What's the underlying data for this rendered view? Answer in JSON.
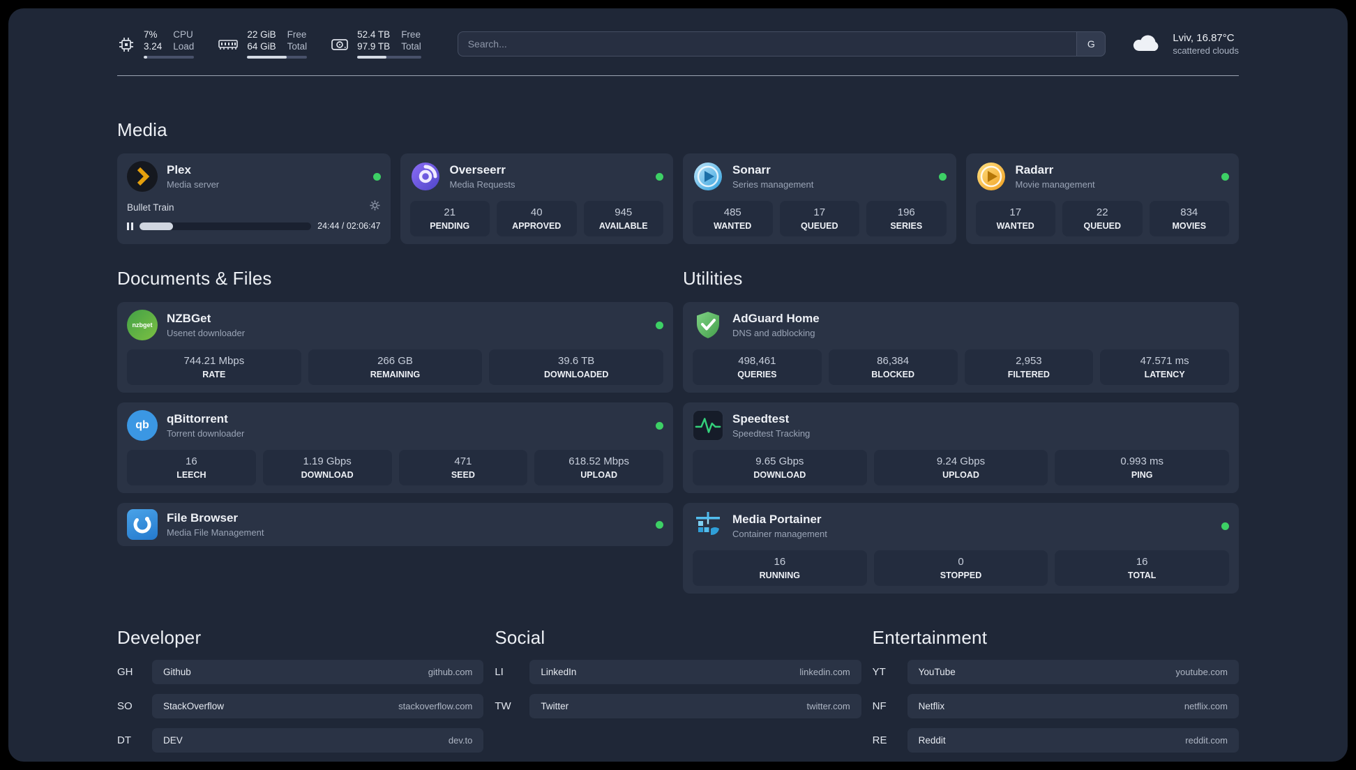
{
  "topbar": {
    "cpu": {
      "usage": "7%",
      "load": "3.24",
      "label1": "CPU",
      "label2": "Load",
      "bar_pct": 7
    },
    "memory": {
      "free": "22 GiB",
      "total": "64 GiB",
      "label1": "Free",
      "label2": "Total",
      "bar_pct": 66
    },
    "disk": {
      "free": "52.4 TB",
      "total": "97.9 TB",
      "label1": "Free",
      "label2": "Total",
      "bar_pct": 46
    },
    "search": {
      "placeholder": "Search...",
      "button_label": "G"
    },
    "weather": {
      "location": "Lviv, 16.87°C",
      "description": "scattered clouds"
    }
  },
  "colors": {
    "status_online": "#3dd065",
    "plex_accent": "#e5a00d"
  },
  "sections": {
    "media": {
      "title": "Media",
      "plex": {
        "name": "Plex",
        "subtitle": "Media server",
        "icon": "plex-icon",
        "now_playing": "Bullet Train",
        "time": "24:44 / 02:06:47",
        "progress_pct": 19.5
      },
      "overseerr": {
        "name": "Overseerr",
        "subtitle": "Media Requests",
        "icon": "overseerr-icon",
        "stats": [
          {
            "value": "21",
            "label": "PENDING"
          },
          {
            "value": "40",
            "label": "APPROVED"
          },
          {
            "value": "945",
            "label": "AVAILABLE"
          }
        ]
      },
      "sonarr": {
        "name": "Sonarr",
        "subtitle": "Series management",
        "icon": "sonarr-icon",
        "stats": [
          {
            "value": "485",
            "label": "WANTED"
          },
          {
            "value": "17",
            "label": "QUEUED"
          },
          {
            "value": "196",
            "label": "SERIES"
          }
        ]
      },
      "radarr": {
        "name": "Radarr",
        "subtitle": "Movie management",
        "icon": "radarr-icon",
        "stats": [
          {
            "value": "17",
            "label": "WANTED"
          },
          {
            "value": "22",
            "label": "QUEUED"
          },
          {
            "value": "834",
            "label": "MOVIES"
          }
        ]
      }
    },
    "documents": {
      "title": "Documents & Files",
      "nzbget": {
        "name": "NZBGet",
        "subtitle": "Usenet downloader",
        "icon": "nzbget-icon",
        "stats": [
          {
            "value": "744.21 Mbps",
            "label": "RATE"
          },
          {
            "value": "266 GB",
            "label": "REMAINING"
          },
          {
            "value": "39.6 TB",
            "label": "DOWNLOADED"
          }
        ]
      },
      "qbittorrent": {
        "name": "qBittorrent",
        "subtitle": "Torrent downloader",
        "icon": "qbittorrent-icon",
        "stats": [
          {
            "value": "16",
            "label": "LEECH"
          },
          {
            "value": "1.19 Gbps",
            "label": "DOWNLOAD"
          },
          {
            "value": "471",
            "label": "SEED"
          },
          {
            "value": "618.52 Mbps",
            "label": "UPLOAD"
          }
        ]
      },
      "filebrowser": {
        "name": "File Browser",
        "subtitle": "Media File Management",
        "icon": "filebrowser-icon"
      }
    },
    "utilities": {
      "title": "Utilities",
      "adguard": {
        "name": "AdGuard Home",
        "subtitle": "DNS and adblocking",
        "icon": "adguard-icon",
        "stats": [
          {
            "value": "498,461",
            "label": "QUERIES"
          },
          {
            "value": "86,384",
            "label": "BLOCKED"
          },
          {
            "value": "2,953",
            "label": "FILTERED"
          },
          {
            "value": "47.571 ms",
            "label": "LATENCY"
          }
        ]
      },
      "speedtest": {
        "name": "Speedtest",
        "subtitle": "Speedtest Tracking",
        "icon": "speedtest-icon",
        "stats": [
          {
            "value": "9.65 Gbps",
            "label": "DOWNLOAD"
          },
          {
            "value": "9.24 Gbps",
            "label": "UPLOAD"
          },
          {
            "value": "0.993 ms",
            "label": "PING"
          }
        ]
      },
      "portainer": {
        "name": "Media Portainer",
        "subtitle": "Container management",
        "icon": "portainer-icon",
        "stats": [
          {
            "value": "16",
            "label": "RUNNING"
          },
          {
            "value": "0",
            "label": "STOPPED"
          },
          {
            "value": "16",
            "label": "TOTAL"
          }
        ]
      }
    }
  },
  "bookmarks": [
    {
      "title": "Developer",
      "links": [
        {
          "abbr": "GH",
          "name": "Github",
          "url": "github.com"
        },
        {
          "abbr": "SO",
          "name": "StackOverflow",
          "url": "stackoverflow.com"
        },
        {
          "abbr": "DT",
          "name": "DEV",
          "url": "dev.to"
        }
      ]
    },
    {
      "title": "Social",
      "links": [
        {
          "abbr": "LI",
          "name": "LinkedIn",
          "url": "linkedin.com"
        },
        {
          "abbr": "TW",
          "name": "Twitter",
          "url": "twitter.com"
        }
      ]
    },
    {
      "title": "Entertainment",
      "links": [
        {
          "abbr": "YT",
          "name": "YouTube",
          "url": "youtube.com"
        },
        {
          "abbr": "NF",
          "name": "Netflix",
          "url": "netflix.com"
        },
        {
          "abbr": "RE",
          "name": "Reddit",
          "url": "reddit.com"
        }
      ]
    }
  ],
  "icons": [
    "cpu-icon",
    "memory-icon",
    "disk-icon",
    "search-button",
    "cloud-icon",
    "gear-icon",
    "pause-icon",
    "status-dot"
  ]
}
